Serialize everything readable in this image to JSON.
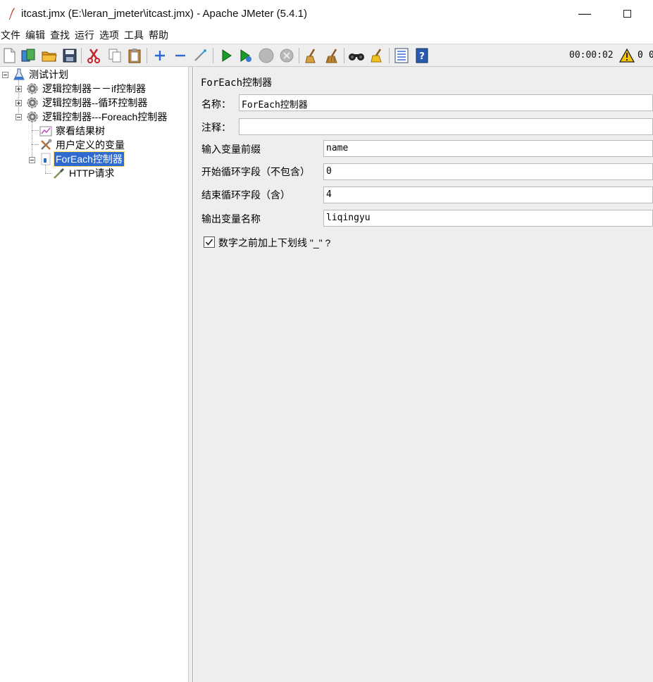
{
  "window": {
    "title": "itcast.jmx (E:\\leran_jmeter\\itcast.jmx) - Apache JMeter (5.4.1)",
    "minimize_glyph": "—"
  },
  "menu": [
    "文件",
    "编辑",
    "查找",
    "运行",
    "选项",
    "工具",
    "帮助"
  ],
  "toolbar": {
    "icons": [
      "new-icon",
      "templates-icon",
      "open-icon",
      "save-icon",
      "cut-icon",
      "copy-icon",
      "paste-icon",
      "expand-icon",
      "collapse-icon",
      "toggle-icon",
      "start-icon",
      "start-no-pause-icon",
      "stop-icon",
      "shutdown-icon",
      "clear-icon",
      "clear-all-icon",
      "search-icon",
      "reset-search-icon",
      "function-helper-icon",
      "help-icon"
    ],
    "timer": "00:00:02",
    "warning_count": "0",
    "extra_count": "0"
  },
  "tree": {
    "items": [
      {
        "label": "测试计划",
        "icon": "test-plan-icon"
      },
      {
        "label": "逻辑控制器－－if控制器",
        "icon": "gear-icon"
      },
      {
        "label": "逻辑控制器--循环控制器",
        "icon": "gear-icon"
      },
      {
        "label": "逻辑控制器---Foreach控制器",
        "icon": "gear-icon"
      },
      {
        "label": "察看结果树",
        "icon": "chart-icon"
      },
      {
        "label": "用户定义的变量",
        "icon": "wrench-icon"
      },
      {
        "label": "ForEach控制器",
        "icon": "foreach-icon",
        "selected": true
      },
      {
        "label": "HTTP请求",
        "icon": "pipette-icon"
      }
    ]
  },
  "form": {
    "title": "ForEach控制器",
    "name_label": "名称：",
    "name_value": "ForEach控制器",
    "comment_label": "注释：",
    "comment_value": "",
    "input_prefix_label": "输入变量前缀",
    "input_prefix_value": "name",
    "start_index_label": "开始循环字段（不包含）",
    "start_index_value": "0",
    "end_index_label": "结束循环字段（含）",
    "end_index_value": "4",
    "output_var_label": "输出变量名称",
    "output_var_value": "liqingyu",
    "separator_checkbox_label": "数字之前加上下划线 \"_\" ?",
    "separator_checked": true
  },
  "colors": {
    "selection": "#2f6ad0",
    "panel_bg": "#eeeeee",
    "run_green": "#1a9a2a"
  }
}
